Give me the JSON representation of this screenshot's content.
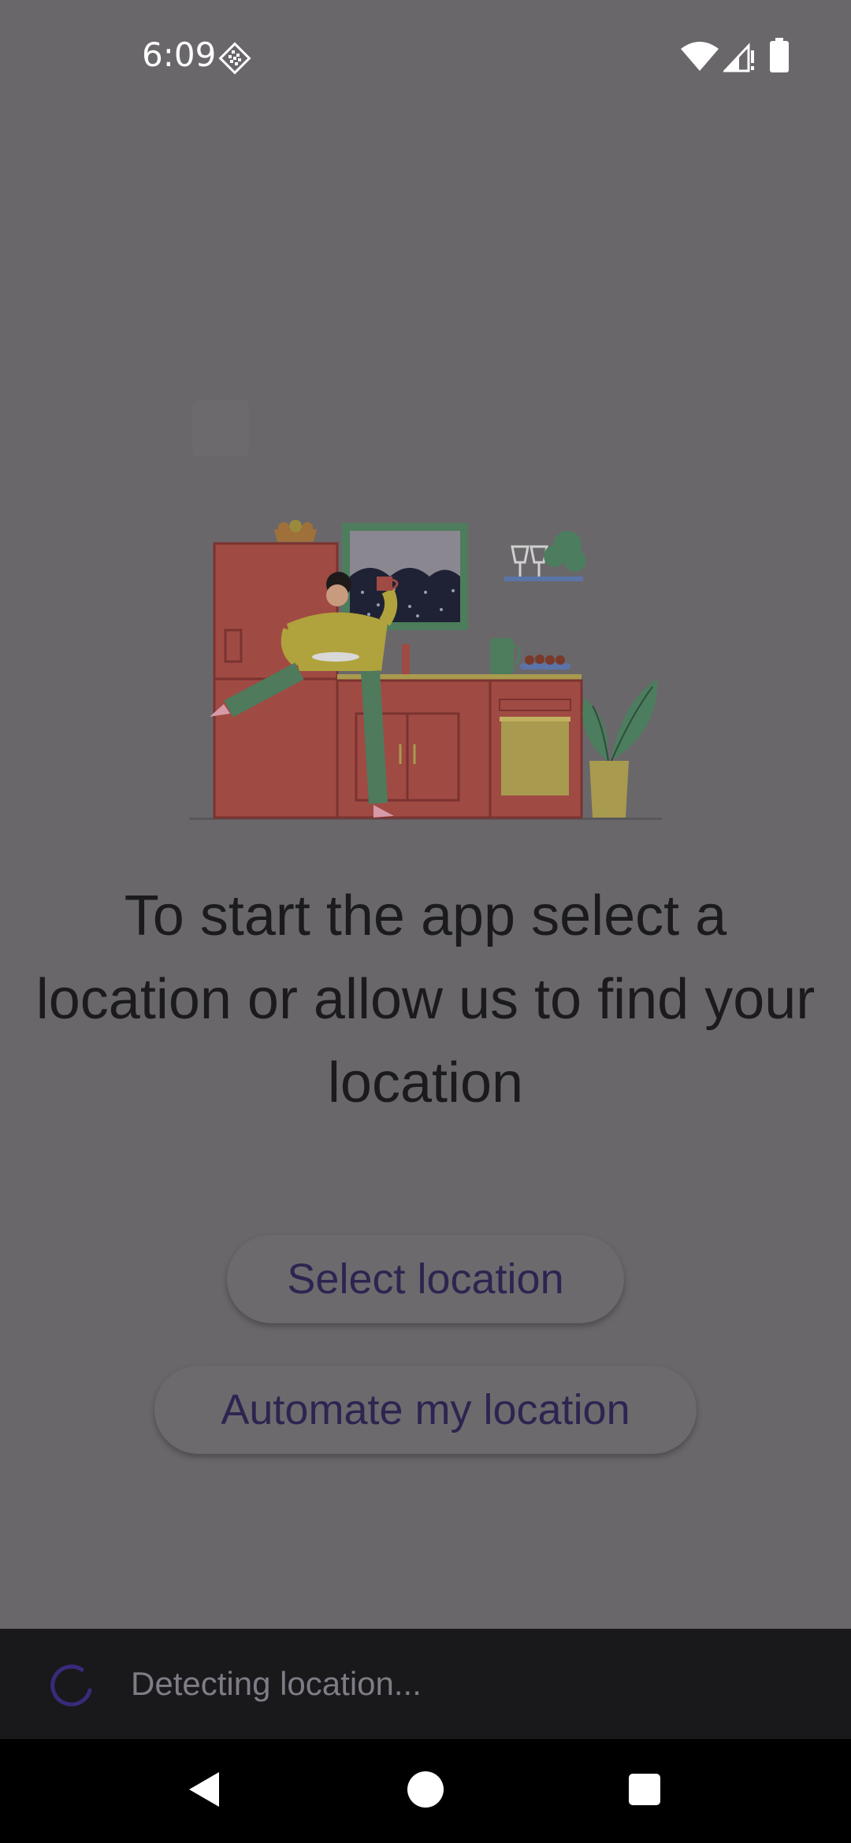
{
  "status_bar": {
    "time": "6:09",
    "left_icon": "notification-sync-icon",
    "right_icons": [
      "wifi-icon",
      "cellular-signal-icon",
      "battery-icon"
    ]
  },
  "illustration": {
    "icon": "kitchen-illustration",
    "colors": {
      "cabinet": "#a04a44",
      "person_top": "#b0a23c",
      "person_pants": "#4f7a5c",
      "plant": "#4c7d5e",
      "window_frame": "#4d7d5c",
      "oven_panel": "#a89a4f"
    }
  },
  "main": {
    "headline": "To start the app select a location or allow us to find your location",
    "select_location_label": "Select location",
    "automate_location_label": "Automate my location"
  },
  "snackbar": {
    "message": "Detecting location...",
    "spinner_color": "#3a2a7a"
  },
  "nav_bar": {
    "back_icon": "back-icon",
    "home_icon": "home-icon",
    "recents_icon": "recents-icon"
  }
}
